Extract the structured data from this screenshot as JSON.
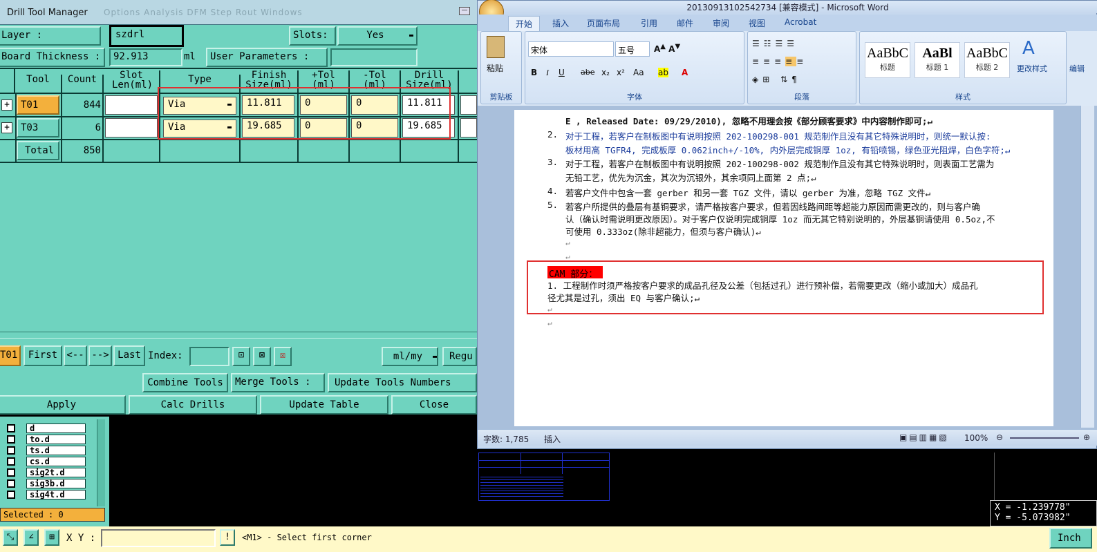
{
  "drill_window": {
    "title": "Drill Tool Manager",
    "ghost_menu": "Options   Analysis   DFM   Step   Rout   Windows",
    "layer_label": "Layer           :",
    "layer_value": "szdrl",
    "slots_label": "Slots:",
    "slots_value": "Yes",
    "board_thickness_label": "Board Thickness :",
    "board_thickness_value": "92.913",
    "board_thickness_unit": "ml",
    "user_params_label": "User Parameters :",
    "headers": [
      "Tool",
      "Count",
      "Slot Len(ml)",
      "Type",
      "Finish Size(ml)",
      "+Tol (ml)",
      "-Tol (ml)",
      "Drill Size(ml)"
    ],
    "rows": [
      {
        "tool": "T01",
        "count": "844",
        "type": "Via",
        "finish": "11.811",
        "ptol": "0",
        "ntol": "0",
        "drill": "11.811"
      },
      {
        "tool": "T03",
        "count": "6",
        "type": "Via",
        "finish": "19.685",
        "ptol": "0",
        "ntol": "0",
        "drill": "19.685"
      }
    ],
    "total_label": "Total",
    "total_count": "850",
    "nav_tool": "T01",
    "first": "First",
    "prev": "<--",
    "next": "-->",
    "last": "Last",
    "index_label": "Index:",
    "unit_select": "ml/my",
    "regu": "Regu",
    "combine_tools": "Combine Tools",
    "merge_tools": "Merge Tools :",
    "update_numbers": "Update Tools Numbers",
    "apply": "Apply",
    "calc_drills": "Calc Drills",
    "update_table": "Update Table",
    "close": "Close"
  },
  "layers": {
    "items": [
      "d",
      "to.d",
      "ts.d",
      "cs.d",
      "sig2t.d",
      "sig3b.d",
      "sig4t.d"
    ],
    "selected": "Selected : 0"
  },
  "cmd": {
    "xy_label": "X Y :",
    "prompt": "<M1> - Select first corner",
    "unit": "Inch"
  },
  "coords": {
    "x": "X = -1.239778\"",
    "y": "Y = -5.073982\""
  },
  "word": {
    "title": "20130913102542734 [兼容模式] - Microsoft Word",
    "tabs": [
      "开始",
      "插入",
      "页面布局",
      "引用",
      "邮件",
      "审阅",
      "视图",
      "Acrobat"
    ],
    "font_name": "宋体",
    "font_size": "五号",
    "paste": "粘贴",
    "groups": [
      "剪贴板",
      "字体",
      "段落",
      "样式"
    ],
    "styles": [
      {
        "big": "AaBbC",
        "label": "标题"
      },
      {
        "big": "AaBl",
        "label": "标题 1"
      },
      {
        "big": "AaBbC",
        "label": "标题 2"
      }
    ],
    "change_styles": "更改样式",
    "edit": "编辑",
    "doc": {
      "line0": "E , Released Date: 09/29/2010), 忽略不用理会按《部分顾客要求》中内容制作即可;↵",
      "p2a": "对于工程，若客户在制板图中有说明按照 202-100298-001 规范制作且没有其它特殊说明时，则统一默认按:",
      "p2b": "板材用高 TGFR4, 完成板厚 0.062inch+/-10%, 内外层完成铜厚 1oz, 有铅喷锡，绿色亚光阻焊，白色字符;↵",
      "p3a": "对于工程，若客户在制板图中有说明按照 202-100298-002 规范制作且没有其它特殊说明时，则表面工艺需为",
      "p3b": "无铅工艺，优先为沉金，其次为沉银外，其余项同上面第 2 点;↵",
      "p4": "若客户文件中包含一套 gerber 和另一套 TGZ 文件，请以 gerber 为准，忽略 TGZ 文件↵",
      "p5a": "若客户所提供的叠层有基铜要求，请严格按客户要求，但若因线路间距等超能力原因而需更改的，则与客户确",
      "p5b": "认（确认时需说明更改原因）。对于客户仅说明完成铜厚 1oz 而无其它特别说明的，外层基铜请使用 0.5oz,不",
      "p5c": "可使用 0.333oz(除非超能力，但须与客户确认)↵",
      "nums": [
        "2.",
        "3.",
        "4.",
        "5."
      ],
      "cam_title": "CAM 部分：",
      "cam1a": "1. 工程制作时须严格按客户要求的成品孔径及公差（包括过孔）进行预补偿，若需要更改（缩小或加大）成品孔",
      "cam1b": "径尤其是过孔，须出 EQ 与客户确认;↵"
    },
    "status_words": "字数: 1,785",
    "status_insert": "插入",
    "zoom": "100%"
  },
  "colors": {
    "panel": "#6fd3bf",
    "highlight_red": "#e03030",
    "tool_orange": "#f3b03c"
  }
}
